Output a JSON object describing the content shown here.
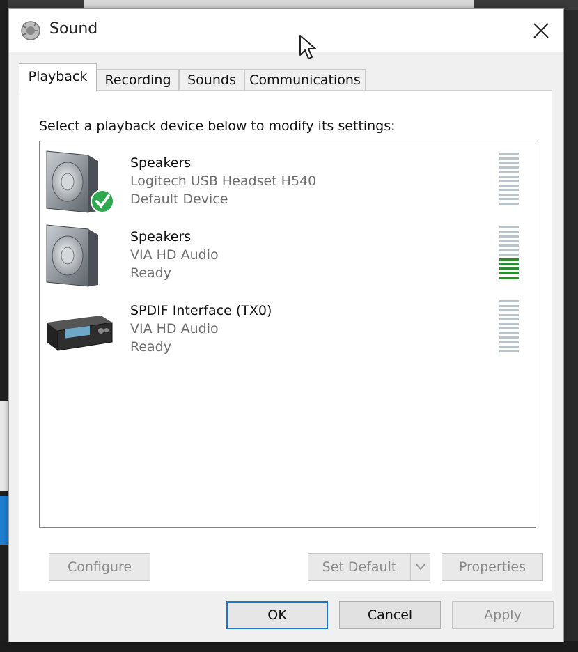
{
  "window": {
    "title": "Sound",
    "icon": "speaker-icon",
    "close": "close-icon"
  },
  "tabs": [
    {
      "label": "Playback",
      "active": true
    },
    {
      "label": "Recording",
      "active": false
    },
    {
      "label": "Sounds",
      "active": false
    },
    {
      "label": "Communications",
      "active": false
    }
  ],
  "instruction": "Select a playback device below to modify its settings:",
  "devices": [
    {
      "name": "Speakers",
      "description": "Logitech USB Headset H540",
      "status": "Default Device",
      "icon": "speaker-default-icon",
      "level": 0
    },
    {
      "name": "Speakers",
      "description": "VIA HD Audio",
      "status": "Ready",
      "icon": "speaker-icon",
      "level": 0.4
    },
    {
      "name": "SPDIF Interface (TX0)",
      "description": "VIA HD Audio",
      "status": "Ready",
      "icon": "spdif-receiver-icon",
      "level": 0
    }
  ],
  "buttons": {
    "configure": "Configure",
    "set_default": "Set Default",
    "properties": "Properties",
    "ok": "OK",
    "cancel": "Cancel",
    "apply": "Apply"
  },
  "colors": {
    "accent": "#1976d2",
    "meter_active": "#2e8b32",
    "meter_idle": "#b8c3cc",
    "check": "#2fa84f"
  }
}
